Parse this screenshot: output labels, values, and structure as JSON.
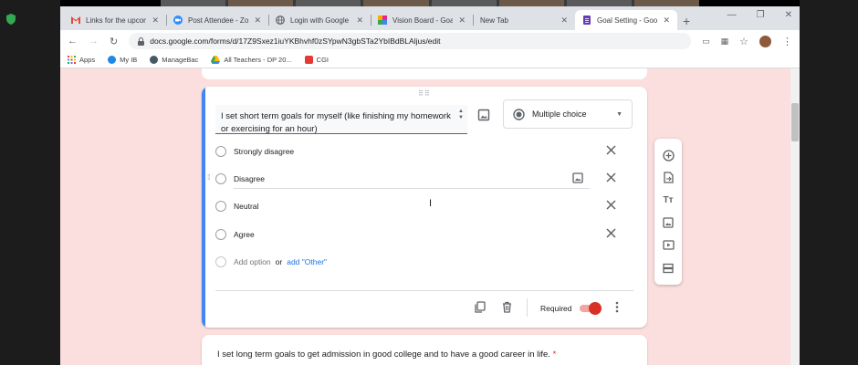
{
  "browser": {
    "tabs": [
      {
        "title": "Links for the upcom",
        "icon": "gmail-icon",
        "color": "#ea4335"
      },
      {
        "title": "Post Attendee - Zoo",
        "icon": "zoom-icon",
        "color": "#2d8cff"
      },
      {
        "title": "Login with Google -",
        "icon": "globe-icon",
        "color": "#5f6368"
      },
      {
        "title": "Vision Board - Goal",
        "icon": "jamboard-icon",
        "color": "#b5366b"
      },
      {
        "title": "New Tab",
        "icon": "none",
        "color": "#5f6368"
      },
      {
        "title": "Goal Setting - Goog",
        "icon": "google-forms-icon",
        "color": "#673ab7",
        "active": true
      }
    ],
    "url": "docs.google.com/forms/d/17Z9Sxez1iuYKBhvhf0zSYpwN3gbSTa2YbIBdBLAljus/edit",
    "bookmarks": [
      {
        "label": "Apps",
        "icon": "apps-grid-icon"
      },
      {
        "label": "My IB",
        "icon": "cloud-icon",
        "color": "#1e88e5"
      },
      {
        "label": "ManageBac",
        "icon": "managebac-icon",
        "color": "#455a64"
      },
      {
        "label": "All Teachers - DP 20...",
        "icon": "drive-icon",
        "color": "#fbbc04"
      },
      {
        "label": "CGI",
        "icon": "red-square-icon",
        "color": "#e53935"
      }
    ]
  },
  "form": {
    "question": "I set short term goals for myself (like finishing my homework or exercising for an hour)",
    "question_type": "Multiple choice",
    "options": [
      "Strongly disagree",
      "Disagree",
      "Neutral",
      "Agree"
    ],
    "add_option": "Add option",
    "or_text": "or",
    "add_other": "add \"Other\"",
    "required_label": "Required",
    "required": true,
    "next_question": "I set long term goals to get admission in good college and to have a good career in life.",
    "next_required_marker": "*"
  },
  "colors": {
    "form_background": "#fbdede",
    "accent_blue": "#4285f4",
    "toggle_red": "#d93025"
  }
}
